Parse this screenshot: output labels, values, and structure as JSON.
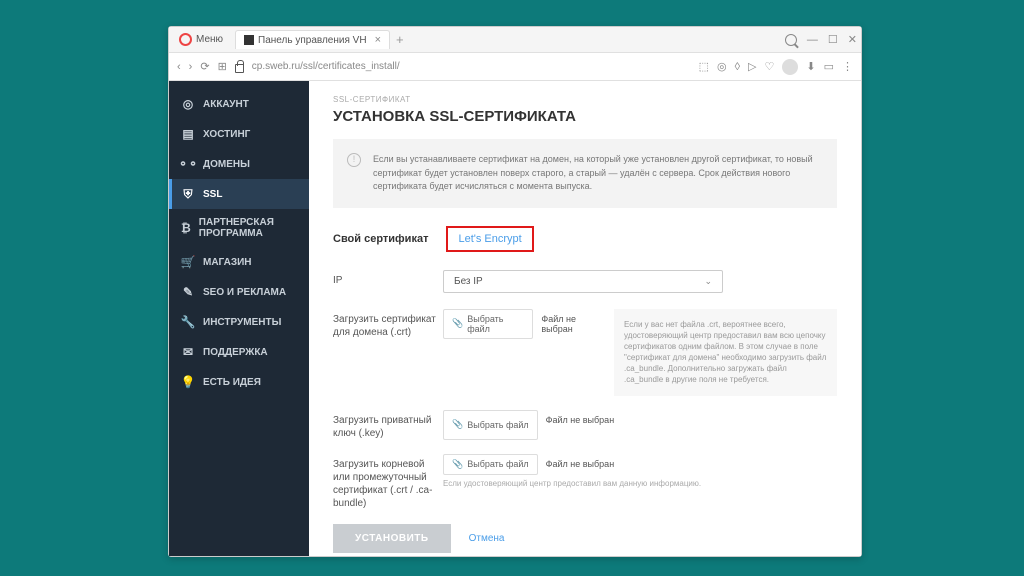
{
  "browser": {
    "menu": "Меню",
    "tab_title": "Панель управления VH",
    "url": "cp.sweb.ru/ssl/certificates_install/"
  },
  "sidebar": {
    "items": [
      {
        "icon": "◎",
        "label": "АККАУНТ"
      },
      {
        "icon": "▤",
        "label": "ХОСТИНГ"
      },
      {
        "icon": "⚬⚬",
        "label": "ДОМЕНЫ"
      },
      {
        "icon": "⛨",
        "label": "SSL"
      },
      {
        "icon": "₿",
        "label": "ПАРТНЕРСКАЯ ПРОГРАММА"
      },
      {
        "icon": "🛒",
        "label": "МАГАЗИН"
      },
      {
        "icon": "✎",
        "label": "SEO И РЕКЛАМА"
      },
      {
        "icon": "🔧",
        "label": "ИНСТРУМЕНТЫ"
      },
      {
        "icon": "✉",
        "label": "ПОДДЕРЖКА"
      },
      {
        "icon": "💡",
        "label": "ЕСТЬ ИДЕЯ"
      }
    ]
  },
  "page": {
    "breadcrumb": "SSL-СЕРТИФИКАТ",
    "title": "УСТАНОВКА SSL-СЕРТИФИКАТА",
    "notice": "Если вы устанавливаете сертификат на домен, на который уже установлен другой сертификат, то новый сертификат будет установлен поверх старого, а старый — удалён с сервера. Срок действия нового сертификата будет исчисляться с момента выпуска.",
    "tabs": {
      "own": "Свой сертификат",
      "le": "Let's Encrypt"
    },
    "ip_label": "IP",
    "ip_value": "Без IP",
    "crt_label": "Загрузить сертификат для домена (.crt)",
    "key_label": "Загрузить приватный ключ (.key)",
    "bundle_label": "Загрузить корневой или промежуточный сертификат (.crt / .ca-bundle)",
    "choose_file": "Выбрать файл",
    "no_file": "Файл не выбран",
    "hint": "Если у вас нет файла .crt, вероятнее всего, удостоверяющий центр предоставил вам всю цепочку сертификатов одним файлом. В этом случае в поле \"сертификат для домена\" необходимо загрузить файл .ca_bundle. Дополнительно загружать файл .ca_bundle в другие поля не требуется.",
    "bundle_hint": "Если удостоверяющий центр предоставил вам данную информацию.",
    "install": "УСТАНОВИТЬ",
    "cancel": "Отмена"
  }
}
